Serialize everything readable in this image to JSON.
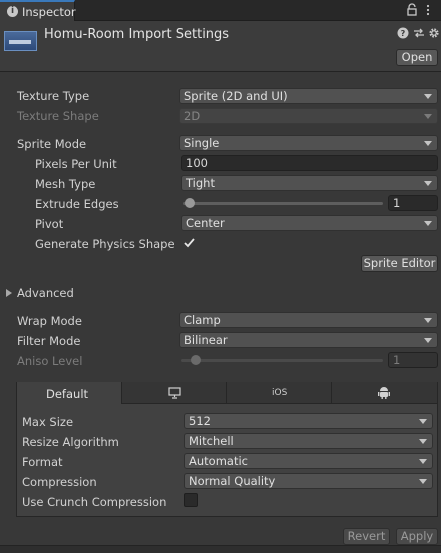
{
  "tab": {
    "label": "Inspector",
    "icon": "info-icon"
  },
  "header": {
    "title": "Homu-Room Import Settings",
    "open_label": "Open"
  },
  "fields": {
    "texture_type": {
      "label": "Texture Type",
      "value": "Sprite (2D and UI)"
    },
    "texture_shape": {
      "label": "Texture Shape",
      "value": "2D"
    },
    "sprite_mode": {
      "label": "Sprite Mode",
      "value": "Single"
    },
    "pixels_per_unit": {
      "label": "Pixels Per Unit",
      "value": "100"
    },
    "mesh_type": {
      "label": "Mesh Type",
      "value": "Tight"
    },
    "extrude_edges": {
      "label": "Extrude Edges",
      "value": "1",
      "level": 1,
      "max": 32
    },
    "pivot": {
      "label": "Pivot",
      "value": "Center"
    },
    "generate_physics_shape": {
      "label": "Generate Physics Shape",
      "checked": true
    },
    "sprite_editor_label": "Sprite Editor",
    "advanced_label": "Advanced",
    "wrap_mode": {
      "label": "Wrap Mode",
      "value": "Clamp"
    },
    "filter_mode": {
      "label": "Filter Mode",
      "value": "Bilinear"
    },
    "aniso_level": {
      "label": "Aniso Level",
      "value": "1",
      "level": 1,
      "max": 16
    }
  },
  "platform": {
    "tabs": [
      {
        "label": "Default",
        "active": true
      },
      {
        "icon": "monitor-icon"
      },
      {
        "label": "iOS"
      },
      {
        "icon": "android-icon"
      }
    ],
    "max_size": {
      "label": "Max Size",
      "value": "512"
    },
    "resize_algorithm": {
      "label": "Resize Algorithm",
      "value": "Mitchell"
    },
    "format": {
      "label": "Format",
      "value": "Automatic"
    },
    "compression": {
      "label": "Compression",
      "value": "Normal Quality"
    },
    "use_crunch": {
      "label": "Use Crunch Compression",
      "checked": false
    }
  },
  "footer": {
    "revert_label": "Revert",
    "apply_label": "Apply"
  }
}
